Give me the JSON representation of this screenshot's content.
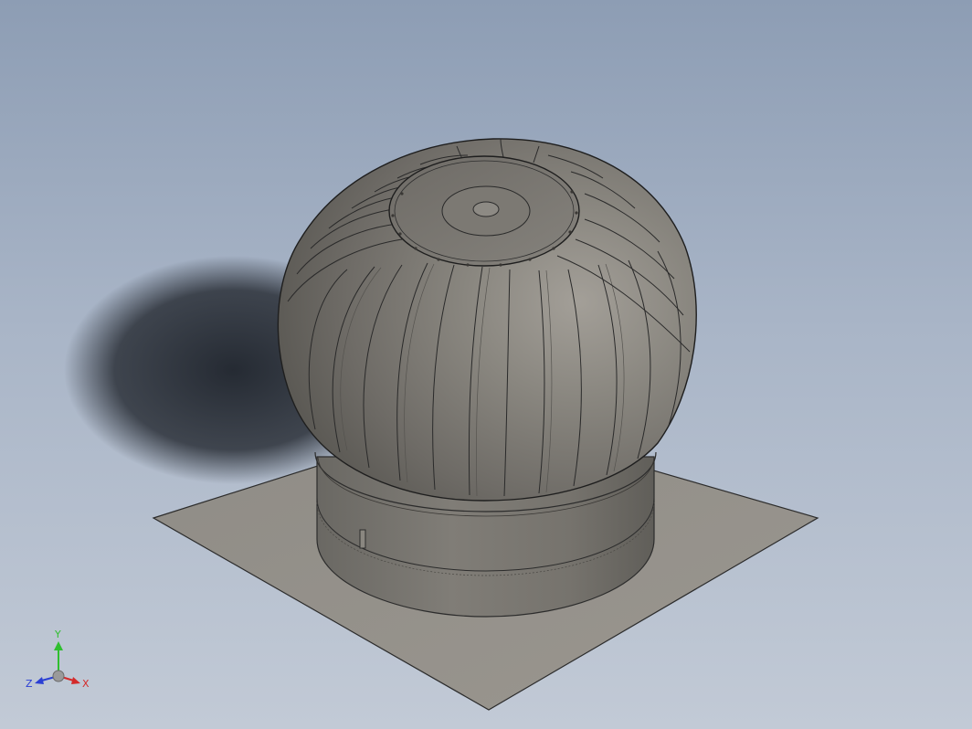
{
  "viewport": {
    "background_top": "#8d9db4",
    "background_bottom": "#c2cad6",
    "model": "turbine-roof-ventilator"
  },
  "triad": {
    "x_label": "X",
    "y_label": "Y",
    "z_label": "Z",
    "x_color": "#d42a2a",
    "y_color": "#2fbf2f",
    "z_color": "#2a3fd4"
  }
}
